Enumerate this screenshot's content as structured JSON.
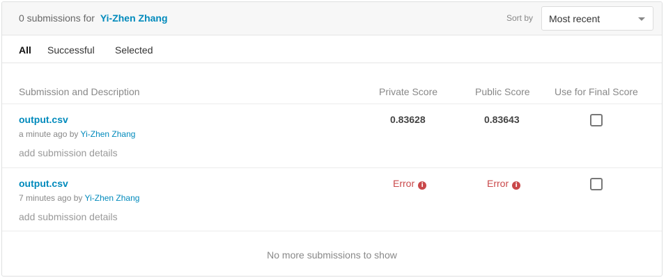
{
  "header": {
    "count_text": "0 submissions for",
    "user": "Yi-Zhen Zhang",
    "sort_label": "Sort by",
    "sort_value": "Most recent"
  },
  "tabs": [
    {
      "label": "All",
      "active": true
    },
    {
      "label": "Successful",
      "active": false
    },
    {
      "label": "Selected",
      "active": false
    }
  ],
  "columns": {
    "submission": "Submission and Description",
    "private": "Private Score",
    "public": "Public Score",
    "final": "Use for Final Score"
  },
  "submissions": [
    {
      "file": "output.csv",
      "time": "a minute ago by",
      "user": "Yi-Zhen Zhang",
      "details": "add submission details",
      "private_score": "0.83628",
      "public_score": "0.83643",
      "selected": false
    },
    {
      "file": "output.csv",
      "time": "7 minutes ago by",
      "user": "Yi-Zhen Zhang",
      "details": "add submission details",
      "private_score": "Error",
      "public_score": "Error",
      "selected": false
    }
  ],
  "footer": "No more submissions to show",
  "colors": {
    "link": "#008abc",
    "error": "#c9484a"
  }
}
